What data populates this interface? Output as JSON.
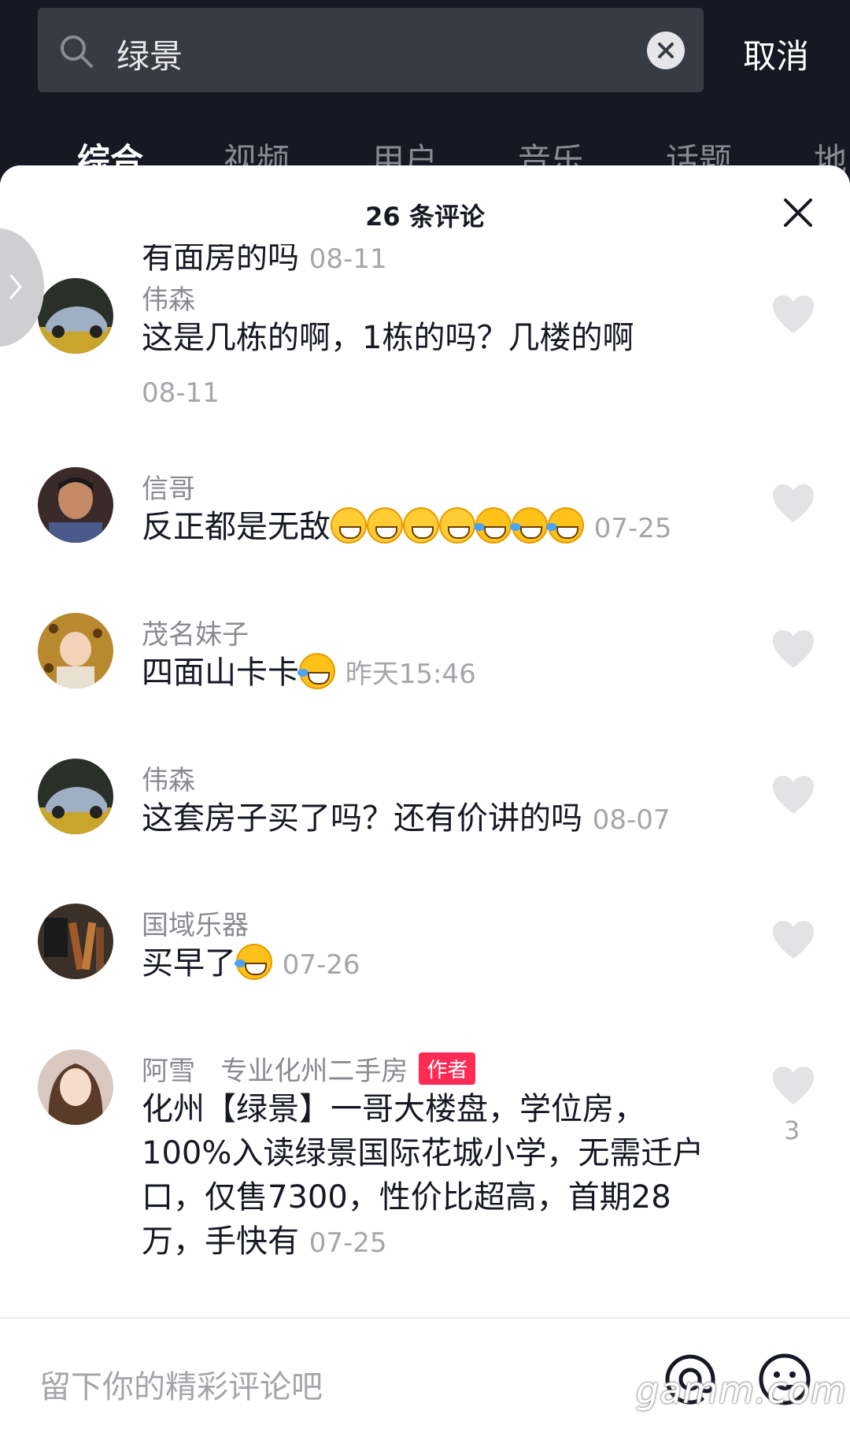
{
  "search": {
    "query": "绿景",
    "cancel_label": "取消"
  },
  "tabs": [
    {
      "label": "综合",
      "active": true
    },
    {
      "label": "视频",
      "active": false
    },
    {
      "label": "用户",
      "active": false
    },
    {
      "label": "音乐",
      "active": false
    },
    {
      "label": "话题",
      "active": false
    },
    {
      "label": "地",
      "active": false
    }
  ],
  "sheet": {
    "title": "26 条评论",
    "cutoff_text": "有面房的吗",
    "cutoff_date": "08-11"
  },
  "comments": [
    {
      "username": "伟森",
      "text": "这是几栋的啊，1栋的吗？几楼的啊",
      "date": "08-11"
    },
    {
      "username": "信哥",
      "text": "反正都是无敌",
      "date": "07-25"
    },
    {
      "username": "茂名妹子",
      "text": "四面山卡卡",
      "date": "昨天15:46"
    },
    {
      "username": "伟森",
      "text": "这套房子买了吗？还有价讲的吗",
      "date": "08-07"
    },
    {
      "username": "国域乐器",
      "text": "买早了",
      "date": "07-26"
    },
    {
      "username": "阿雪",
      "username_suffix": "专业化州二手房",
      "badge": "作者",
      "text": "化州【绿景】一哥大楼盘，学位房，100%入读绿景国际花城小学，无需迁户口，仅售7300，性价比超高，首期28万，手快有",
      "date": "07-25",
      "likes": "3"
    }
  ],
  "input": {
    "placeholder": "留下你的精彩评论吧"
  },
  "watermark": "gamm.com",
  "colors": {
    "background_dark": "#161823",
    "accent_red": "#fe2c55",
    "muted_text": "#8a8b91"
  }
}
